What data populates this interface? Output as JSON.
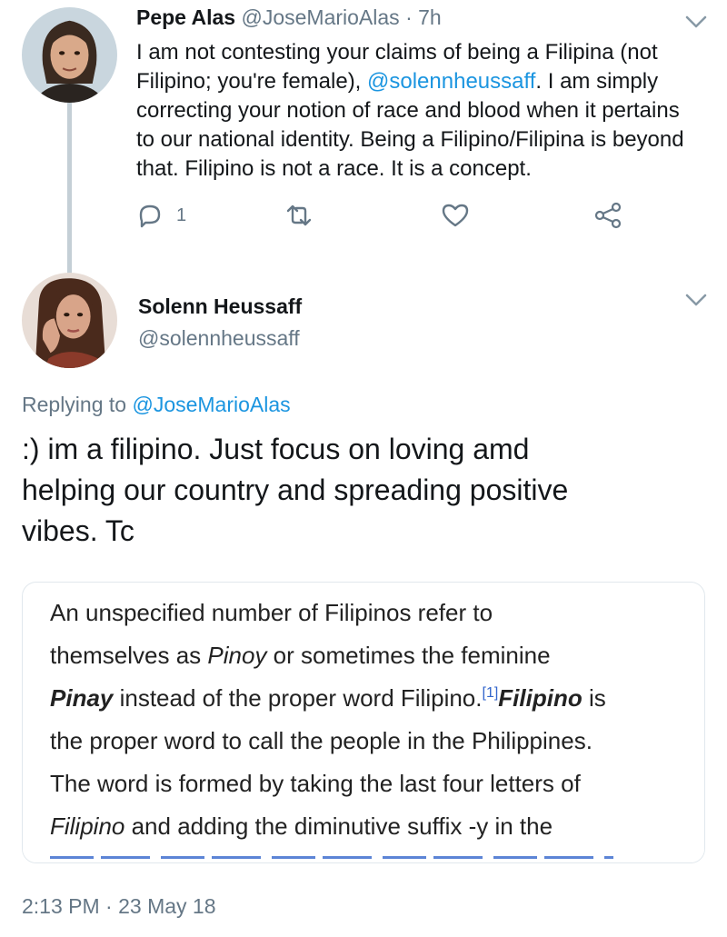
{
  "tweet1": {
    "name": "Pepe Alas",
    "handle": "@JoseMarioAlas",
    "separator": "·",
    "time": "7h",
    "body_lines": [
      "I am not contesting your claims of being a Filipina (not",
      "Filipino; you're female), ",
      "correcting your notion of race and blood when it pertains",
      "to our national identity. Being a Filipino/Filipina is beyond",
      "that. Filipino is not a race. It is a concept."
    ],
    "mention": "@solennheussaff",
    "line2_tail": ". I am simply",
    "reply_count": "1"
  },
  "tweet2": {
    "name": "Solenn Heussaff",
    "handle": "@solennheussaff",
    "replying_prefix": "Replying to ",
    "replying_mention": "@JoseMarioAlas",
    "body_lines": [
      ":) im a filipino.  Just focus on loving amd",
      "helping our country and spreading positive",
      "vibes. Tc"
    ],
    "timestamp": "2:13 PM · 23 May 18"
  },
  "card": {
    "l1": "An unspecified number of Filipinos refer to",
    "l2_a": "themselves as ",
    "l2_i": "Pinoy",
    "l2_b": " or sometimes the feminine",
    "l3_bi": "Pinay",
    "l3_a": " instead of the proper word Filipino.",
    "l3_sup": "[1]",
    "l3_bi2": "Filipino",
    "l3_b": " is",
    "l4": "the proper word to call the people in the Philippines.",
    "l5": "The word is formed by taking the last four letters of",
    "l6_i": "Filipino",
    "l6_a": " and adding the diminutive suffix -y in the"
  },
  "icons": {
    "reply": "reply-icon",
    "retweet": "retweet-icon",
    "like": "heart-icon",
    "share": "share-icon",
    "more": "chevron-down-icon"
  },
  "colors": {
    "link": "#1b95e0",
    "secondary_text": "#657786",
    "thread_line": "#c4cfd6"
  }
}
